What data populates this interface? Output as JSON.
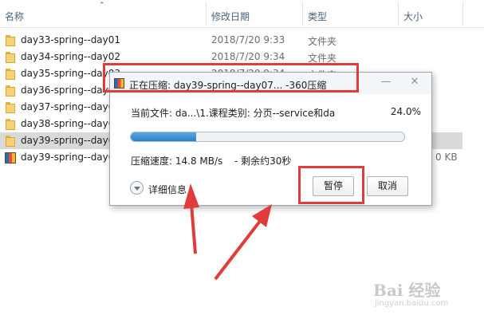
{
  "columns": {
    "name": "名称",
    "date": "修改日期",
    "type": "类型",
    "size": "大小"
  },
  "files": [
    {
      "name": "day33-spring--day01",
      "date": "2018/7/20 9:33",
      "type": "文件夹",
      "size": "",
      "icon": "folder-icon"
    },
    {
      "name": "day34-spring--day02",
      "date": "2018/7/20 9:34",
      "type": "文件夹",
      "size": "",
      "icon": "folder-icon"
    },
    {
      "name": "day35-spring--day03",
      "date": "2018/7/20 9:34",
      "type": "文件夹",
      "size": "",
      "icon": "folder-icon"
    },
    {
      "name": "day36-spring--day0",
      "date": "",
      "type": "",
      "size": "",
      "icon": "folder-icon"
    },
    {
      "name": "day37-spring--day0",
      "date": "",
      "type": "",
      "size": "",
      "icon": "folder-icon"
    },
    {
      "name": "day38-spring--day0",
      "date": "",
      "type": "",
      "size": "",
      "icon": "folder-icon"
    },
    {
      "name": "day39-spring--day0",
      "date": "",
      "type": "",
      "size": "",
      "icon": "folder-icon",
      "selected": true
    },
    {
      "name": "day39-spring--day0",
      "date": "",
      "type": "",
      "size": "0 KB",
      "icon": "archive-icon"
    }
  ],
  "dialog": {
    "title": "正在压缩: day39-spring--day07... -360压缩",
    "current_file": "当前文件: da...\\1.课程类别: 分页--service和da",
    "percent": "24.0%",
    "progress": 0.24,
    "speed": "压缩速度: 14.8 MB/s",
    "remaining": "- 剩余约30秒",
    "details_label": "详细信息",
    "pause_label": "暂停",
    "cancel_label": "取消",
    "minimize_icon": "minimize-icon",
    "close_icon": "close-icon"
  },
  "watermark": {
    "main": "Bai 经验",
    "sub": "jingyan.baidu.com"
  },
  "colors": {
    "annotation": "#e03c3c",
    "progress": "#2e7fc8",
    "selected_row": "#d9d9d9"
  }
}
